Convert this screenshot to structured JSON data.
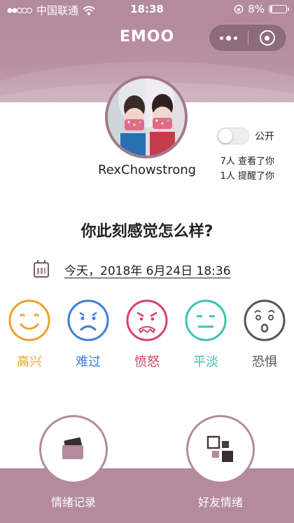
{
  "status_bar": {
    "carrier": "中国联通",
    "time": "18:38",
    "battery": "8%",
    "battery_level": 0.08
  },
  "header": {
    "app_title": "EMOO"
  },
  "profile": {
    "username": "RexChowstrong",
    "public_label": "公开",
    "public_on": false,
    "viewed_text": "7人 查看了你",
    "reminded_text": "1人 提醒了你"
  },
  "main": {
    "question": "你此刻感觉怎么样?",
    "date_text": "今天，2018年 6月24日 18:36"
  },
  "moods": [
    {
      "label": "高兴",
      "color": "#f0a02a",
      "icon": "happy-face-icon"
    },
    {
      "label": "难过",
      "color": "#3b7fd6",
      "icon": "sad-face-icon"
    },
    {
      "label": "愤怒",
      "color": "#d9406a",
      "icon": "angry-face-icon"
    },
    {
      "label": "平淡",
      "color": "#3fc0b3",
      "icon": "neutral-face-icon"
    },
    {
      "label": "恐惧",
      "color": "#555555",
      "icon": "fear-face-icon"
    }
  ],
  "bottom_nav": {
    "records_label": "情绪记录",
    "friends_label": "好友情绪",
    "accent": "#b48a9d"
  }
}
